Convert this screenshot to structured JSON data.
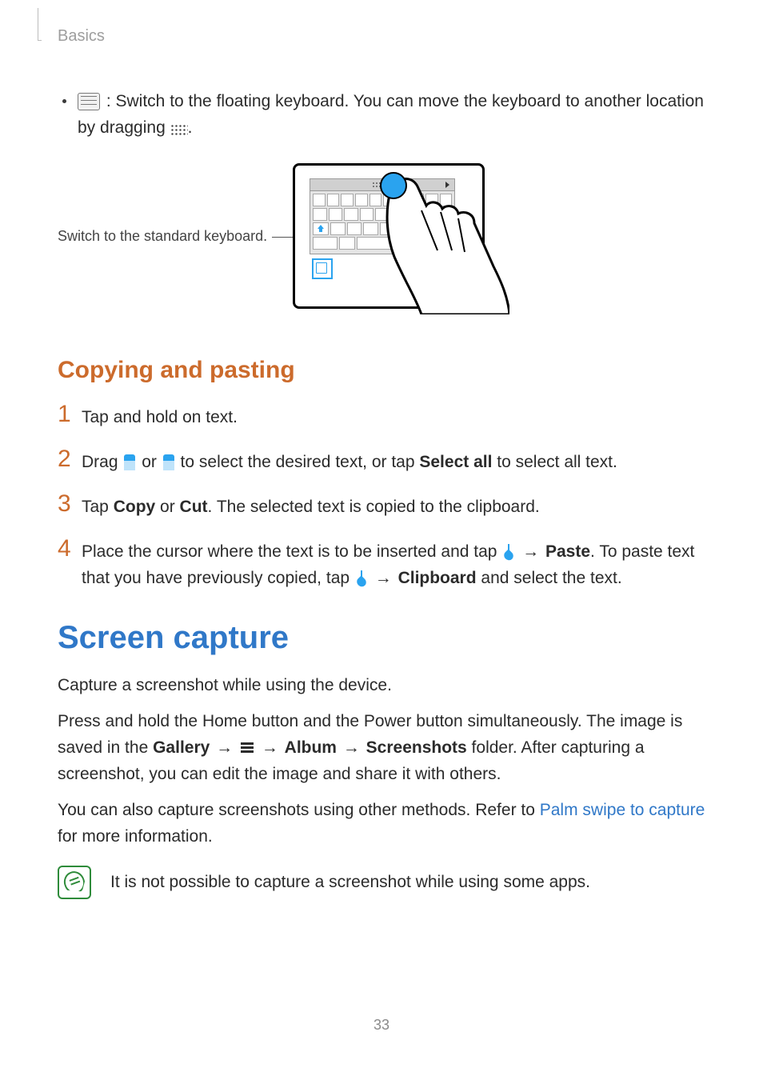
{
  "header": {
    "section": "Basics"
  },
  "bullet": {
    "text_a": " : Switch to the floating keyboard. You can move the keyboard to another location by dragging ",
    "text_b": "."
  },
  "figure": {
    "caption": "Switch to the standard keyboard."
  },
  "copy_paste": {
    "heading": "Copying and pasting",
    "steps": {
      "s1": "Tap and hold on text.",
      "s2_a": "Drag ",
      "s2_b": " or ",
      "s2_c": " to select the desired text, or tap ",
      "s2_select_all": "Select all",
      "s2_d": " to select all text.",
      "s3_a": "Tap ",
      "s3_copy": "Copy",
      "s3_b": " or ",
      "s3_cut": "Cut",
      "s3_c": ". The selected text is copied to the clipboard.",
      "s4_a": "Place the cursor where the text is to be inserted and tap ",
      "s4_arrow1": " → ",
      "s4_paste": "Paste",
      "s4_b": ". To paste text that you have previously copied, tap ",
      "s4_arrow2": " → ",
      "s4_clipboard": "Clipboard",
      "s4_c": " and select the text."
    }
  },
  "screen_capture": {
    "heading": "Screen capture",
    "p1": "Capture a screenshot while using the device.",
    "p2_a": "Press and hold the Home button and the Power button simultaneously. The image is saved in the ",
    "p2_gallery": "Gallery",
    "p2_arrow1": " → ",
    "p2_arrow2": " → ",
    "p2_album": "Album",
    "p2_arrow3": " → ",
    "p2_screenshots": "Screenshots",
    "p2_b": " folder. After capturing a screenshot, you can edit the image and share it with others.",
    "p3_a": "You can also capture screenshots using other methods. Refer to ",
    "p3_link": "Palm swipe to capture",
    "p3_b": " for more information.",
    "note": "It is not possible to capture a screenshot while using some apps."
  },
  "page_number": "33"
}
